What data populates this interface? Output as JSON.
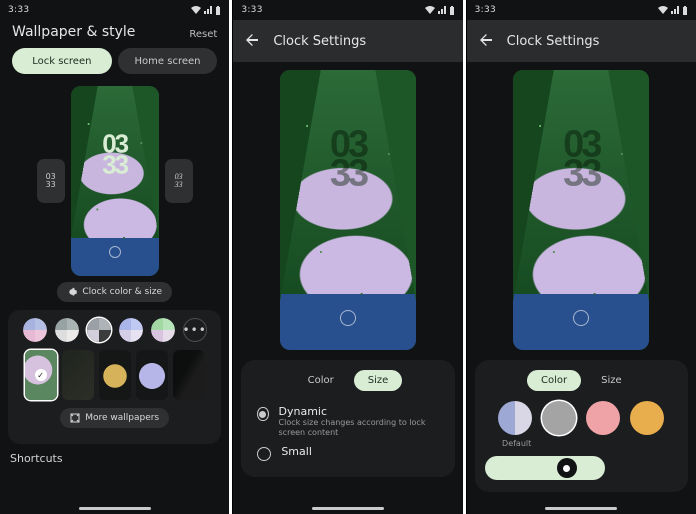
{
  "status": {
    "time": "3:33"
  },
  "phone1": {
    "title": "Wallpaper & style",
    "reset": "Reset",
    "tab_lock": "Lock screen",
    "tab_home": "Home screen",
    "side_time": "03\n33",
    "side_time_alt": "03\n33",
    "preview_time": "03\n33",
    "clock_color_size": "Clock color & size",
    "more_wallpapers": "More wallpapers",
    "section_shortcuts": "Shortcuts"
  },
  "phone2": {
    "title": "Clock Settings",
    "seg_color": "Color",
    "seg_size": "Size",
    "dynamic_title": "Dynamic",
    "dynamic_sub": "Clock size changes according to lock screen content",
    "small": "Small",
    "preview_time": "03\n33"
  },
  "phone3": {
    "title": "Clock Settings",
    "seg_color": "Color",
    "seg_size": "Size",
    "default_label": "Default",
    "preview_time": "03\n33"
  },
  "swatches1": [
    {
      "q1": "#a7b3de",
      "q2": "#b6c0e4",
      "q3": "#e8b9d5",
      "q4": "#eec6dc",
      "selected": false
    },
    {
      "q1": "#97a2a2",
      "q2": "#aab4b3",
      "q3": "#dedede",
      "q4": "#edeaea",
      "selected": false
    },
    {
      "q1": "#9aa0a5",
      "q2": "#aeb3b7",
      "q3": "#d2cedb",
      "q4": "#3a3c3d",
      "selected": true
    },
    {
      "q1": "#aab5ea",
      "q2": "#c0c9f1",
      "q3": "#d4cfe6",
      "q4": "#e6e2f2",
      "selected": false
    },
    {
      "q1": "#a1d8a4",
      "q2": "#b7e4ba",
      "q3": "#d9c4df",
      "q4": "#e7dce9",
      "selected": false
    }
  ],
  "swatches3": [
    {
      "type": "bisection",
      "lh": "#9ea8d5",
      "rh": "#d9d7e6",
      "selected": false
    },
    {
      "type": "solid",
      "color": "#a4a4a4",
      "selected": true
    },
    {
      "type": "solid",
      "color": "#f0a3a7",
      "selected": false
    },
    {
      "type": "solid",
      "color": "#e8ad4d",
      "selected": false
    }
  ]
}
